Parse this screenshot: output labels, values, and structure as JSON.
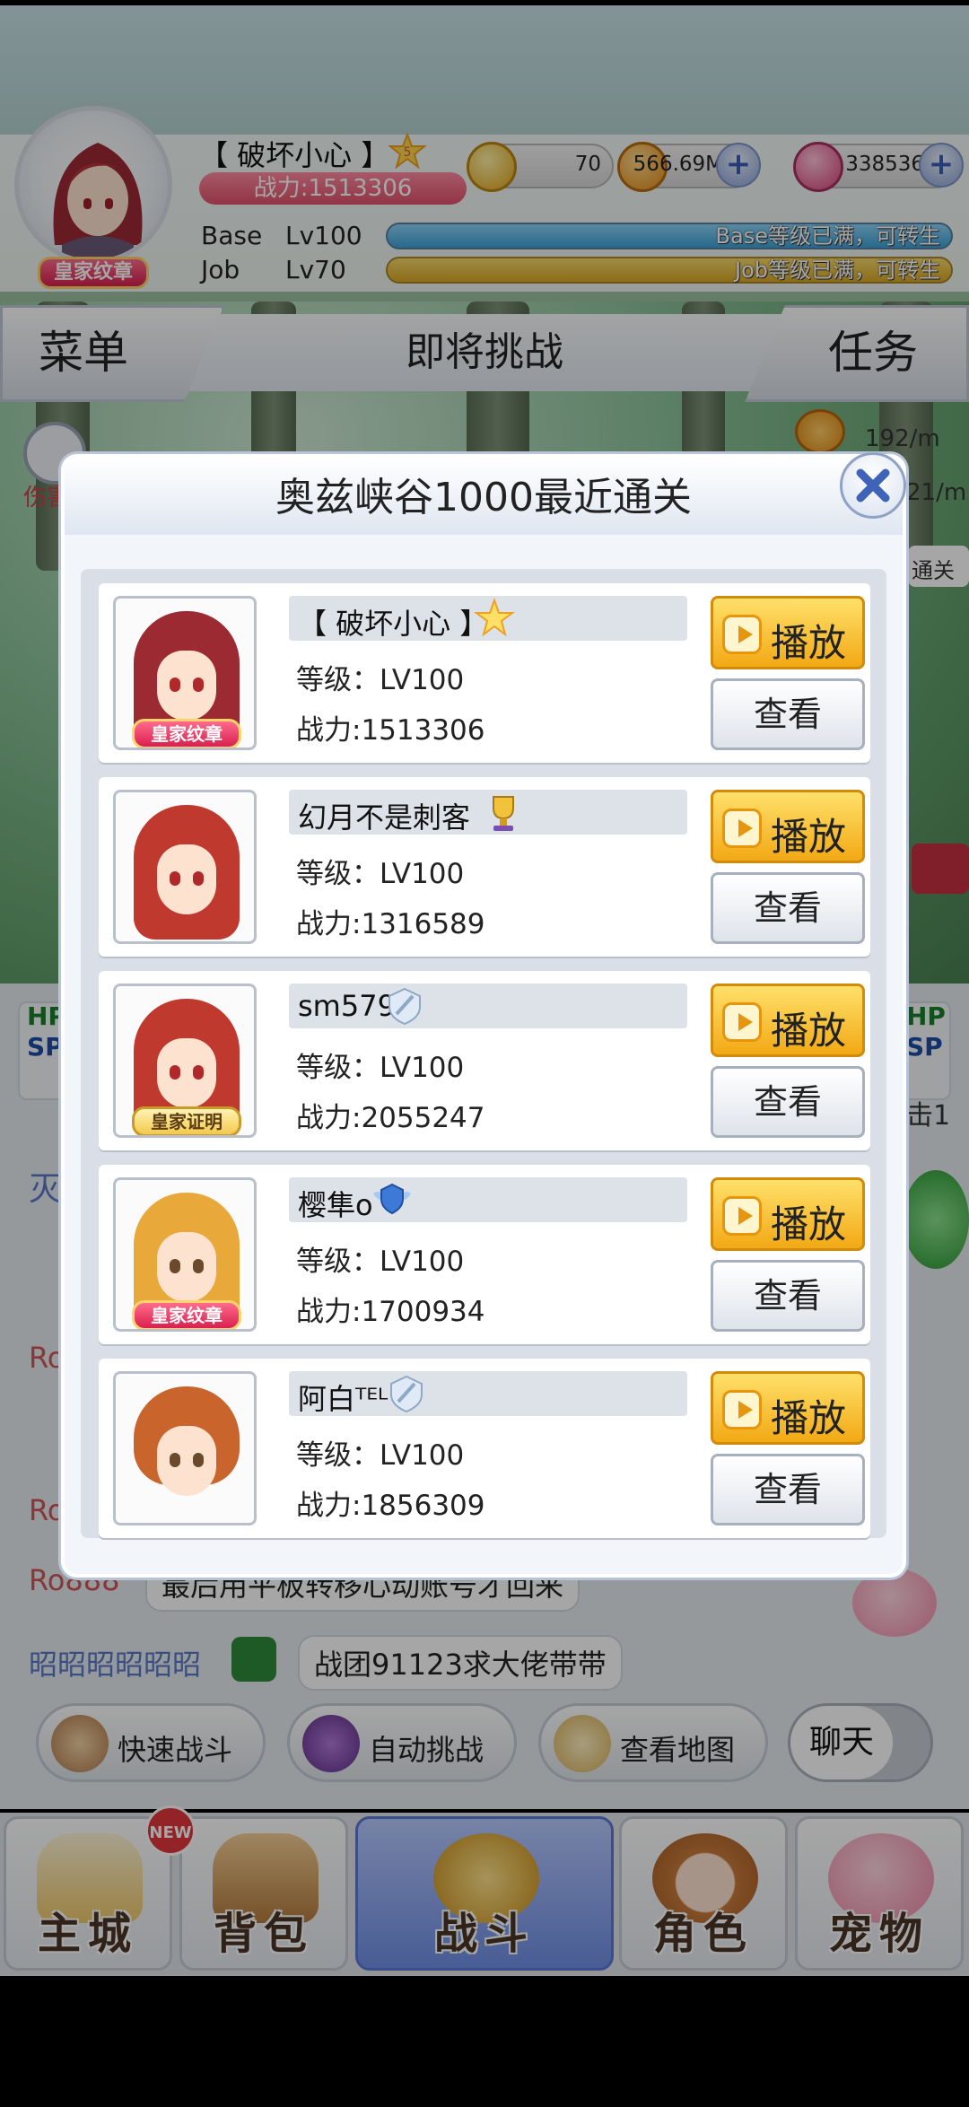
{
  "player": {
    "name": "【 破坏小心 】",
    "power": "战力:1513306",
    "badge": "皇家纹章",
    "base_label": "Base",
    "base_level": "Lv100",
    "base_status": "Base等级已满，可转生",
    "job_label": "Job",
    "job_level": "Lv70",
    "job_status": "Job等级已满，可转生"
  },
  "resources": {
    "token": "70",
    "zeny": "566.69M",
    "gems": "338536"
  },
  "nav": {
    "menu": "菜单",
    "title": "即将挑战",
    "quest": "任务"
  },
  "scene": {
    "rate1": "192/m",
    "rate2": "21/m",
    "pass_text": "通关",
    "dmg_label": "伤害",
    "hp": "HP",
    "sp": "SP",
    "side_text": "击1",
    "frag_mie": "灭",
    "frag_ro": "Ro"
  },
  "chat": [
    {
      "who": "Ro888",
      "msg": "最后用平板转移心动账号才回来"
    },
    {
      "who": "昭昭昭昭昭昭",
      "msg": "战团91123求大佬带带"
    }
  ],
  "actions": {
    "quick_battle": "快速战斗",
    "auto_challenge": "自动挑战",
    "view_map": "查看地图",
    "chat_toggle": "聊天"
  },
  "bottom_nav": [
    {
      "label": "主城",
      "badge": "NEW"
    },
    {
      "label": "背包"
    },
    {
      "label": "战斗"
    },
    {
      "label": "角色"
    },
    {
      "label": "宠物"
    }
  ],
  "modal": {
    "title": "奥兹峡谷1000最近通关",
    "play_label": "播放",
    "view_label": "查看",
    "entries": [
      {
        "name": "【 破坏小心 】",
        "level": "等级：LV100",
        "power": "战力:1513306",
        "badge": "皇家纹章",
        "emblem": "star-5-icon"
      },
      {
        "name": "幻月不是刺客",
        "level": "等级：LV100",
        "power": "战力:1316589",
        "badge": "",
        "emblem": "trophy-icon"
      },
      {
        "name": "sm579",
        "level": "等级：LV100",
        "power": "战力:2055247",
        "badge": "皇家证明",
        "emblem": "sword-shield-icon"
      },
      {
        "name": "樱隼o",
        "level": "等级：LV100",
        "power": "战力:1700934",
        "badge": "皇家纹章",
        "emblem": "blue-wing-shield-icon"
      },
      {
        "name": "阿白ᵀᴱᴸ",
        "level": "等级：LV100",
        "power": "战力:1856309",
        "badge": "",
        "emblem": "sword-shield-icon"
      }
    ]
  }
}
